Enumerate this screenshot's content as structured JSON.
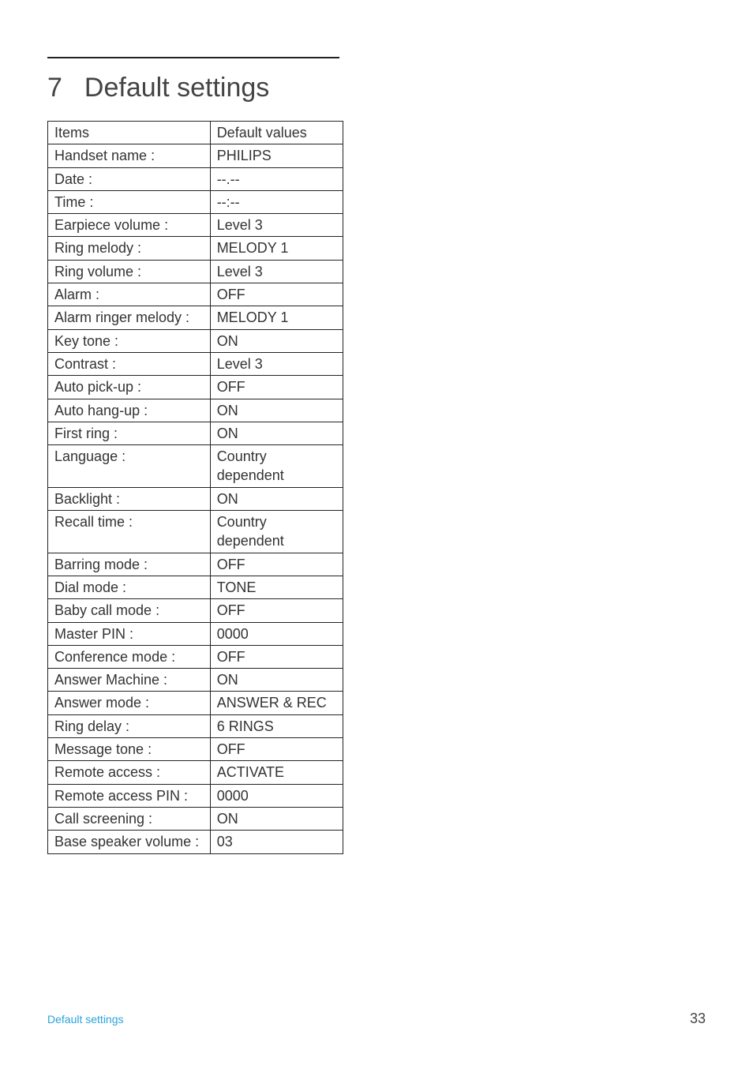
{
  "section_number": "7",
  "section_title": "Default settings",
  "table": {
    "headers": {
      "items": "Items",
      "values": "Default values"
    },
    "rows": [
      {
        "item": "Handset name :",
        "value": "PHILIPS"
      },
      {
        "item": "Date :",
        "value": "--.--"
      },
      {
        "item": "Time :",
        "value": "--:--"
      },
      {
        "item": "Earpiece volume :",
        "value": "Level 3"
      },
      {
        "item": "Ring melody :",
        "value": "MELODY 1"
      },
      {
        "item": "Ring volume :",
        "value": "Level 3"
      },
      {
        "item": "Alarm :",
        "value": "OFF"
      },
      {
        "item": "Alarm ringer melody :",
        "value": "MELODY 1"
      },
      {
        "item": "Key tone :",
        "value": "ON"
      },
      {
        "item": "Contrast :",
        "value": "Level 3"
      },
      {
        "item": "Auto pick-up :",
        "value": "OFF"
      },
      {
        "item": "Auto hang-up :",
        "value": "ON"
      },
      {
        "item": "First ring :",
        "value": "ON"
      },
      {
        "item": "Language :",
        "value": "Country dependent"
      },
      {
        "item": "Backlight :",
        "value": "ON"
      },
      {
        "item": "Recall time :",
        "value": "Country dependent"
      },
      {
        "item": "Barring mode :",
        "value": "OFF"
      },
      {
        "item": "Dial mode :",
        "value": "TONE"
      },
      {
        "item": "Baby call mode :",
        "value": "OFF"
      },
      {
        "item": "Master PIN :",
        "value": "0000"
      },
      {
        "item": "Conference mode :",
        "value": "OFF"
      },
      {
        "item": "Answer Machine :",
        "value": "ON"
      },
      {
        "item": "Answer mode :",
        "value": "ANSWER & REC"
      },
      {
        "item": "Ring delay :",
        "value": "6 RINGS"
      },
      {
        "item": "Message tone :",
        "value": "OFF"
      },
      {
        "item": "Remote access :",
        "value": "ACTIVATE"
      },
      {
        "item": "Remote access PIN :",
        "value": "0000"
      },
      {
        "item": "Call screening :",
        "value": "ON"
      },
      {
        "item": "Base speaker volume :",
        "value": "03"
      }
    ]
  },
  "footer": {
    "label": "Default settings",
    "page_number": "33"
  }
}
